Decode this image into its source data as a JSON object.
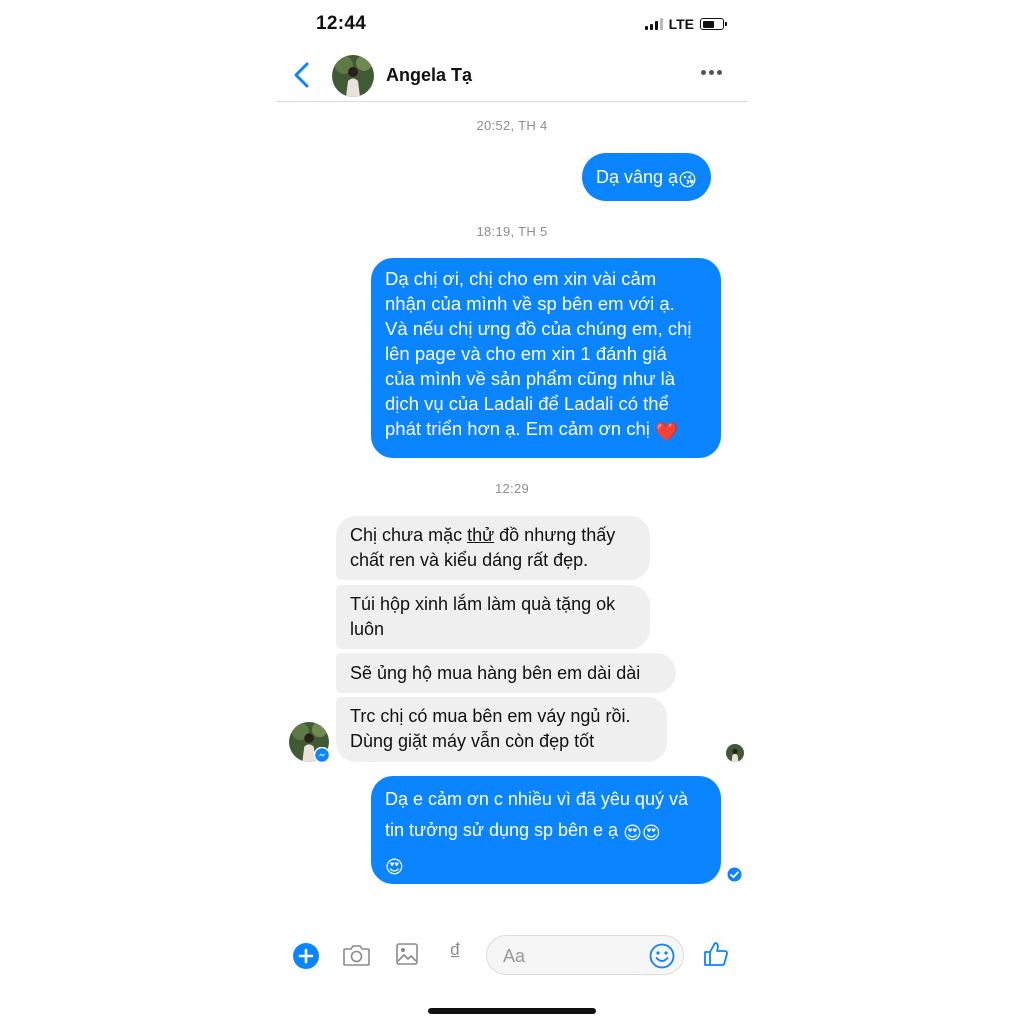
{
  "status_bar": {
    "time": "12:44",
    "network": "LTE"
  },
  "header": {
    "contact_name": "Angela Tạ"
  },
  "messages": [
    {
      "timestamp": "20:52, TH 4"
    },
    {
      "direction": "out",
      "text": "Dạ vâng ạ",
      "emoji": "😘"
    },
    {
      "timestamp": "18:19, TH 5"
    },
    {
      "direction": "out",
      "text": "Dạ chị ơi, chị cho em xin vài cảm\nnhận của mình về sp bên em với ạ.\nVà nếu chị ưng đồ của chúng em, chị\nlên page và cho em xin 1 đánh giá\ncủa mình về sản phẩm cũng như là\ndịch vụ của Ladali để Ladali có thể\nphát triển hơn ạ. Em cảm ơn chị",
      "emoji": "❤️"
    },
    {
      "timestamp": "12:29"
    },
    {
      "direction": "in",
      "text_before": "Chị chưa mặc ",
      "underlined": "thử",
      "text_after": " đồ nhưng thấy\nchất ren và kiểu dáng rất đẹp."
    },
    {
      "direction": "in",
      "text": "Túi hộp xinh lắm làm quà tặng ok\nluôn"
    },
    {
      "direction": "in",
      "text": "Sẽ ủng hộ mua hàng bên em dài dài"
    },
    {
      "direction": "in",
      "text": "Trc chị có mua bên em váy ngủ rồi.\nDùng giặt máy vẫn còn đẹp tốt"
    },
    {
      "direction": "out",
      "text": "Dạ e cảm ơn c nhiều vì đã yêu quý và\ntin tưởng sử dụng sp bên e ạ",
      "emoji_inline": "😍😍",
      "emoji_last_line": "😍"
    }
  ],
  "composer": {
    "placeholder": "Aa",
    "currency_symbol": "₫"
  },
  "colors": {
    "accent": "#0a84ff",
    "incoming_bubble": "#efefef"
  },
  "icons": [
    "back-icon",
    "more-icon",
    "plus-icon",
    "camera-icon",
    "image-icon",
    "payment-icon",
    "emoji-icon",
    "like-icon",
    "messenger-badge-icon",
    "seen-check-icon"
  ]
}
